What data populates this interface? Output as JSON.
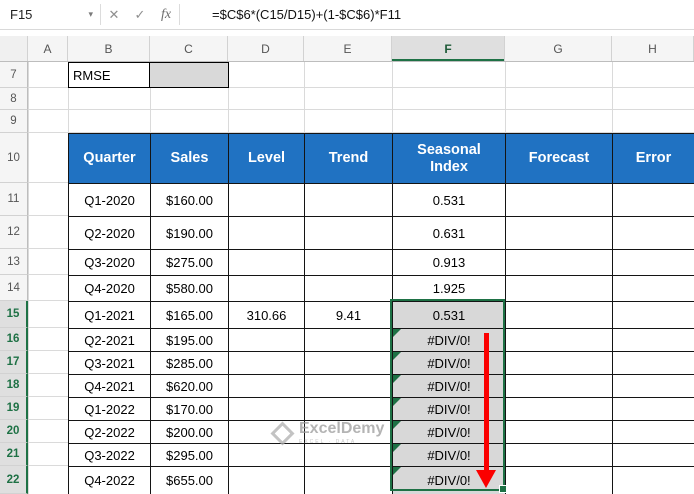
{
  "formula_bar": {
    "name_box_value": "F15",
    "formula": "=$C$6*(C15/D15)+(1-$C$6)*F11"
  },
  "icons": {
    "name_box_dropdown": "▾",
    "cancel": "✕",
    "enter": "✓",
    "insert_function": "fx"
  },
  "column_headers": [
    "A",
    "B",
    "C",
    "D",
    "E",
    "F",
    "G",
    "H"
  ],
  "row_headers": [
    "7",
    "8",
    "9",
    "10",
    "11",
    "12",
    "13",
    "14",
    "15",
    "16",
    "17",
    "18",
    "19",
    "20",
    "21",
    "22"
  ],
  "sheet": {
    "rmse_label": "RMSE"
  },
  "table": {
    "headers": [
      "Quarter",
      "Sales",
      "Level",
      "Trend",
      "Seasonal Index",
      "Forecast",
      "Error"
    ],
    "rows": [
      {
        "quarter": "Q1-2020",
        "sales": "$160.00",
        "level": "",
        "trend": "",
        "seasonal": "0.531",
        "forecast": "",
        "error": ""
      },
      {
        "quarter": "Q2-2020",
        "sales": "$190.00",
        "level": "",
        "trend": "",
        "seasonal": "0.631",
        "forecast": "",
        "error": ""
      },
      {
        "quarter": "Q3-2020",
        "sales": "$275.00",
        "level": "",
        "trend": "",
        "seasonal": "0.913",
        "forecast": "",
        "error": ""
      },
      {
        "quarter": "Q4-2020",
        "sales": "$580.00",
        "level": "",
        "trend": "",
        "seasonal": "1.925",
        "forecast": "",
        "error": ""
      },
      {
        "quarter": "Q1-2021",
        "sales": "$165.00",
        "level": "310.66",
        "trend": "9.41",
        "seasonal": "0.531",
        "forecast": "",
        "error": ""
      },
      {
        "quarter": "Q2-2021",
        "sales": "$195.00",
        "level": "",
        "trend": "",
        "seasonal": "#DIV/0!",
        "forecast": "",
        "error": ""
      },
      {
        "quarter": "Q3-2021",
        "sales": "$285.00",
        "level": "",
        "trend": "",
        "seasonal": "#DIV/0!",
        "forecast": "",
        "error": ""
      },
      {
        "quarter": "Q4-2021",
        "sales": "$620.00",
        "level": "",
        "trend": "",
        "seasonal": "#DIV/0!",
        "forecast": "",
        "error": ""
      },
      {
        "quarter": "Q1-2022",
        "sales": "$170.00",
        "level": "",
        "trend": "",
        "seasonal": "#DIV/0!",
        "forecast": "",
        "error": ""
      },
      {
        "quarter": "Q2-2022",
        "sales": "$200.00",
        "level": "",
        "trend": "",
        "seasonal": "#DIV/0!",
        "forecast": "",
        "error": ""
      },
      {
        "quarter": "Q3-2022",
        "sales": "$295.00",
        "level": "",
        "trend": "",
        "seasonal": "#DIV/0!",
        "forecast": "",
        "error": ""
      },
      {
        "quarter": "Q4-2022",
        "sales": "$655.00",
        "level": "",
        "trend": "",
        "seasonal": "#DIV/0!",
        "forecast": "",
        "error": ""
      }
    ]
  },
  "selection": {
    "active_cell": "F15",
    "range": "F15:F22"
  },
  "watermark": {
    "brand": "ExcelDemy",
    "tagline": "EXCEL · DATA"
  },
  "colors": {
    "table_header_blue": "#2072C2",
    "selection_green": "#1E7145",
    "selection_fill": "#D8D8D8",
    "arrow_red": "#FB0000",
    "rmse_cell_fill": "#D9D9D9"
  }
}
